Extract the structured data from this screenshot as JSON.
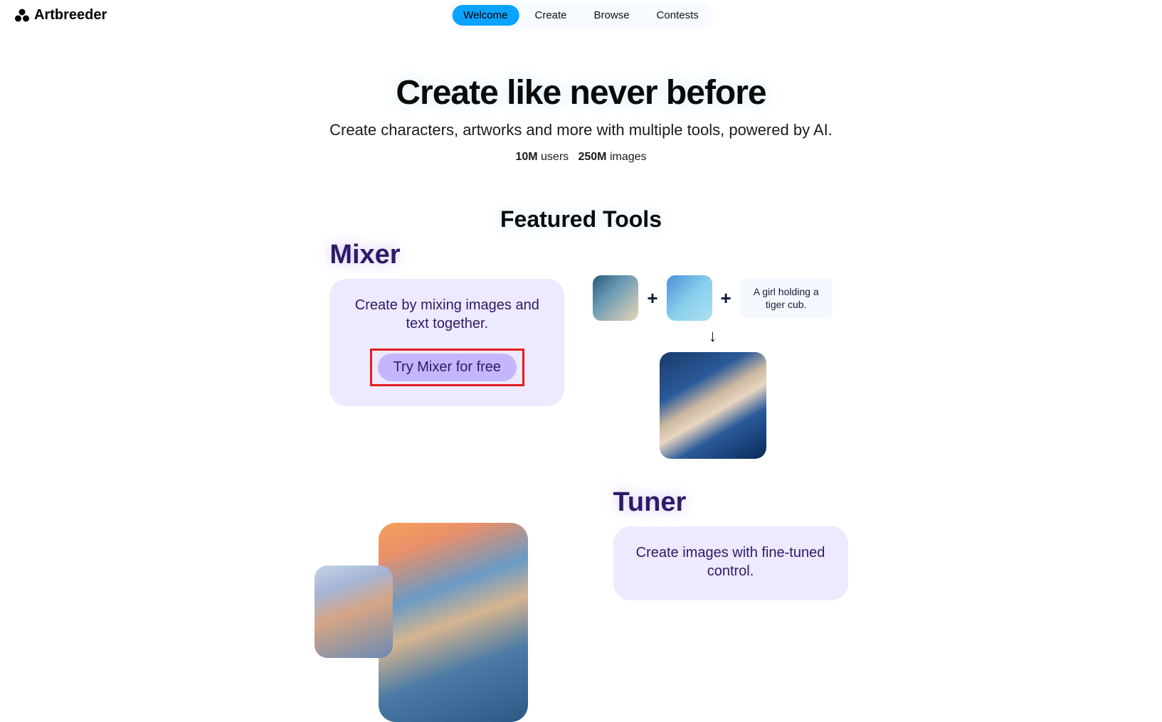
{
  "brand": "Artbreeder",
  "nav": {
    "items": [
      {
        "label": "Welcome",
        "active": true
      },
      {
        "label": "Create",
        "active": false
      },
      {
        "label": "Browse",
        "active": false
      },
      {
        "label": "Contests",
        "active": false
      }
    ]
  },
  "hero": {
    "title": "Create like never before",
    "subtitle": "Create characters, artworks and more with multiple tools, powered by AI.",
    "stat1_value": "10M",
    "stat1_label": "users",
    "stat2_value": "250M",
    "stat2_label": "images"
  },
  "featured": {
    "heading": "Featured Tools"
  },
  "mixer": {
    "title": "Mixer",
    "desc": "Create by mixing images and text together.",
    "cta": "Try Mixer for free",
    "prompt": "A girl holding a tiger cub."
  },
  "tuner": {
    "title": "Tuner",
    "desc": "Create images with fine-tuned control."
  },
  "symbols": {
    "plus": "+",
    "arrow_down": "↓"
  }
}
